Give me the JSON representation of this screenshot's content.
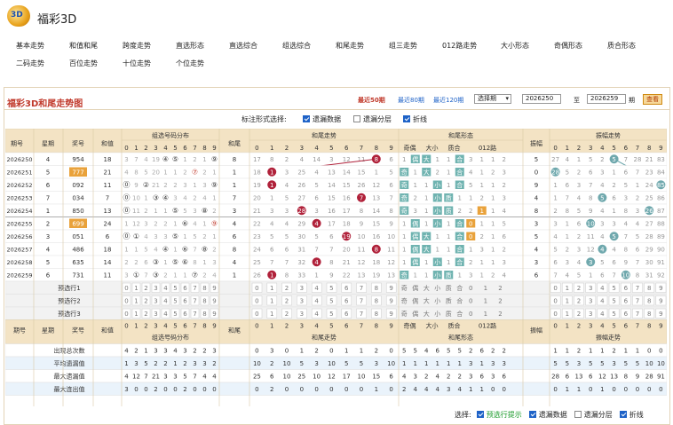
{
  "brand": "福彩3D",
  "nav": [
    "基本走势",
    "和值和尾",
    "跨度走势",
    "直选形态",
    "直选综合",
    "组选综合",
    "和尾走势",
    "组三走势",
    "012路走势",
    "大小形态",
    "奇偶形态",
    "质合形态",
    "二码走势",
    "百位走势",
    "十位走势",
    "个位走势"
  ],
  "panel_title": "福彩3D和尾走势图",
  "range_links": [
    "最近50期",
    "最近80期",
    "最近120期"
  ],
  "period_select": "选择期",
  "from_value": "2026250",
  "to_label": "至",
  "to_value": "2026259",
  "period_unit": "期",
  "query_button": "查看",
  "options_label": "标注形式选择:",
  "options": [
    {
      "label": "遗漏数据",
      "checked": true
    },
    {
      "label": "遗漏分层",
      "checked": false
    },
    {
      "label": "折线",
      "checked": true
    }
  ],
  "colors": {
    "accent_red": "#c0392b",
    "header_bg": "#f3e3c4",
    "sum_line": "#b0213a",
    "amp_line": "#6fa8ad",
    "blue_cb": "#1e62c7"
  },
  "headers": {
    "issue": "期号",
    "week": "星期",
    "prize": "奖号",
    "sum": "和值",
    "group_dist": "组选号码分布",
    "sum_tail": "和尾",
    "sum_tail_trend": "和尾走势",
    "sum_form": "和尾形态",
    "odd_even": "奇偶",
    "big_small": "大小",
    "prime": "质合",
    "road": "012路",
    "amplitude": "振幅",
    "amp_trend": "振幅走势"
  },
  "form_labels": {
    "odd": "奇",
    "even": "偶",
    "big": "大",
    "small": "小",
    "prime": "质",
    "composite": "合"
  },
  "digits": [
    "0",
    "1",
    "2",
    "3",
    "4",
    "5",
    "6",
    "7",
    "8",
    "9"
  ],
  "roads": [
    "0",
    "1",
    "2"
  ],
  "rows": [
    {
      "issue": "2026250",
      "week": "4",
      "prize": "954",
      "sum": "18",
      "dist": [
        "3",
        "7",
        "4",
        "19",
        "④",
        "⑤",
        "1",
        "2",
        "1",
        "⑨"
      ],
      "tail": "8",
      "tt": [
        "17",
        "8",
        "2",
        "4",
        "14",
        "3",
        "12",
        "11",
        "8",
        "6"
      ],
      "fm": [
        "1",
        "偶",
        "大",
        "1",
        "1",
        "合",
        "3",
        "1",
        "1",
        "2"
      ],
      "amp": "5",
      "at": [
        "27",
        "4",
        "1",
        "5",
        "2",
        "5",
        "7",
        "28",
        "21",
        "83"
      ]
    },
    {
      "issue": "2026251",
      "week": "5",
      "prize": "777",
      "sum": "21",
      "dist": [
        "4",
        "8",
        "5",
        "20",
        "1",
        "1",
        "2",
        "⑦",
        "2",
        "1"
      ],
      "tail": "1",
      "tt": [
        "18",
        "1",
        "3",
        "25",
        "4",
        "13",
        "14",
        "15",
        "1",
        "5"
      ],
      "fm": [
        "奇",
        "1",
        "大",
        "2",
        "1",
        "合",
        "4",
        "1",
        "2",
        "3"
      ],
      "amp": "0",
      "at": [
        "28",
        "5",
        "2",
        "6",
        "3",
        "1",
        "6",
        "7",
        "23",
        "84"
      ]
    },
    {
      "issue": "2026252",
      "week": "6",
      "prize": "092",
      "sum": "11",
      "dist": [
        "⓪",
        "9",
        "②",
        "21",
        "2",
        "2",
        "3",
        "1",
        "3",
        "⑨"
      ],
      "tail": "1",
      "tt": [
        "19",
        "1",
        "4",
        "26",
        "5",
        "14",
        "15",
        "26",
        "12",
        "6"
      ],
      "fm": [
        "奇",
        "1",
        "1",
        "小",
        "1",
        "合",
        "5",
        "1",
        "1",
        "2"
      ],
      "amp": "9",
      "at": [
        "1",
        "6",
        "3",
        "7",
        "4",
        "2",
        "5",
        "1",
        "24",
        "85"
      ]
    },
    {
      "issue": "2026253",
      "week": "7",
      "prize": "034",
      "sum": "7",
      "dist": [
        "⓪",
        "10",
        "1",
        "③",
        "④",
        "3",
        "4",
        "2",
        "4",
        "1"
      ],
      "tail": "7",
      "tt": [
        "20",
        "1",
        "5",
        "27",
        "6",
        "15",
        "16",
        "7",
        "13",
        "7"
      ],
      "fm": [
        "奇",
        "2",
        "1",
        "小",
        "质",
        "1",
        "1",
        "2",
        "1",
        "3"
      ],
      "amp": "4",
      "at": [
        "1",
        "7",
        "4",
        "8",
        "5",
        "6",
        "3",
        "2",
        "25",
        "86"
      ]
    },
    {
      "issue": "2026254",
      "week": "1",
      "prize": "850",
      "sum": "13",
      "dist": [
        "⓪",
        "11",
        "2",
        "1",
        "1",
        "⑤",
        "5",
        "3",
        "⑧",
        "2"
      ],
      "tail": "3",
      "tt": [
        "21",
        "3",
        "3",
        "28",
        "3",
        "16",
        "17",
        "8",
        "14",
        "8"
      ],
      "fm": [
        "奇",
        "3",
        "1",
        "小",
        "质",
        "2",
        "2",
        "0",
        "1",
        "4"
      ],
      "amp": "8",
      "at": [
        "2",
        "8",
        "5",
        "9",
        "4",
        "1",
        "8",
        "3",
        "26",
        "87"
      ]
    },
    {
      "issue": "2026255",
      "week": "2",
      "prize": "699",
      "sum": "24",
      "dist": [
        "1",
        "12",
        "3",
        "2",
        "2",
        "1",
        "⑥",
        "4",
        "1",
        "⑨"
      ],
      "tail": "4",
      "tt": [
        "22",
        "4",
        "4",
        "29",
        "4",
        "17",
        "18",
        "9",
        "15",
        "9"
      ],
      "fm": [
        "1",
        "偶",
        "1",
        "小",
        "1",
        "合",
        "0",
        "1",
        "1",
        "5"
      ],
      "amp": "3",
      "at": [
        "3",
        "1",
        "6",
        "10",
        "3",
        "3",
        "4",
        "4",
        "27",
        "88"
      ]
    },
    {
      "issue": "2026256",
      "week": "3",
      "prize": "051",
      "sum": "6",
      "dist": [
        "⓪",
        "①",
        "4",
        "3",
        "3",
        "⑤",
        "1",
        "5",
        "2",
        "1"
      ],
      "tail": "6",
      "tt": [
        "23",
        "5",
        "5",
        "30",
        "5",
        "6",
        "19",
        "10",
        "16",
        "10"
      ],
      "fm": [
        "1",
        "偶",
        "大",
        "1",
        "1",
        "合",
        "0",
        "2",
        "1",
        "6"
      ],
      "amp": "5",
      "at": [
        "4",
        "1",
        "2",
        "11",
        "4",
        "5",
        "7",
        "5",
        "28",
        "89"
      ]
    },
    {
      "issue": "2026257",
      "week": "4",
      "prize": "486",
      "sum": "18",
      "dist": [
        "1",
        "1",
        "5",
        "4",
        "④",
        "1",
        "⑥",
        "7",
        "⑧",
        "2"
      ],
      "tail": "8",
      "tt": [
        "24",
        "6",
        "6",
        "31",
        "7",
        "7",
        "20",
        "11",
        "8",
        "11"
      ],
      "fm": [
        "1",
        "偶",
        "大",
        "1",
        "1",
        "合",
        "1",
        "3",
        "1",
        "2"
      ],
      "amp": "4",
      "at": [
        "5",
        "2",
        "3",
        "12",
        "4",
        "4",
        "8",
        "6",
        "29",
        "90"
      ]
    },
    {
      "issue": "2026258",
      "week": "5",
      "prize": "635",
      "sum": "14",
      "dist": [
        "2",
        "2",
        "6",
        "③",
        "1",
        "⑤",
        "⑥",
        "8",
        "1",
        "3"
      ],
      "tail": "4",
      "tt": [
        "25",
        "7",
        "7",
        "32",
        "4",
        "8",
        "21",
        "12",
        "18",
        "12"
      ],
      "fm": [
        "1",
        "偶",
        "1",
        "小",
        "1",
        "合",
        "2",
        "1",
        "1",
        "3"
      ],
      "amp": "3",
      "at": [
        "6",
        "3",
        "4",
        "3",
        "5",
        "6",
        "9",
        "7",
        "30",
        "91"
      ]
    },
    {
      "issue": "2026259",
      "week": "6",
      "prize": "731",
      "sum": "11",
      "dist": [
        "3",
        "①",
        "7",
        "③",
        "2",
        "1",
        "1",
        "⑦",
        "2",
        "4"
      ],
      "tail": "1",
      "tt": [
        "26",
        "1",
        "8",
        "33",
        "1",
        "9",
        "22",
        "13",
        "19",
        "13"
      ],
      "fm": [
        "奇",
        "1",
        "1",
        "小",
        "质",
        "1",
        "3",
        "1",
        "2",
        "4"
      ],
      "amp": "6",
      "at": [
        "7",
        "4",
        "5",
        "1",
        "6",
        "7",
        "10",
        "8",
        "31",
        "92"
      ]
    }
  ],
  "line_sum": [
    8,
    1,
    1,
    7,
    3,
    4,
    6,
    8,
    4,
    1
  ],
  "line_amp": [
    5,
    7,
    0,
    4,
    8,
    3,
    5,
    4,
    3,
    6
  ],
  "highlight_prizes": [
    "777",
    "699"
  ],
  "pre_rows": [
    {
      "label": "预选行1"
    },
    {
      "label": "预选行2"
    },
    {
      "label": "预选行3"
    }
  ],
  "pre_form": [
    "奇",
    "偶",
    "大",
    "小",
    "质",
    "合",
    "0",
    "1",
    "2"
  ],
  "stat_rows": [
    {
      "label": "出现总次数",
      "dist": [
        "4",
        "2",
        "1",
        "3",
        "3",
        "4",
        "3",
        "2",
        "2",
        "3"
      ],
      "tt": [
        "0",
        "3",
        "0",
        "1",
        "2",
        "0",
        "1",
        "1",
        "2",
        "0"
      ],
      "fm": [
        "5",
        "5",
        "4",
        "6",
        "5",
        "5",
        "2",
        "6",
        "2",
        "2"
      ],
      "at": [
        "1",
        "1",
        "2",
        "1",
        "1",
        "2",
        "1",
        "1",
        "0",
        "0"
      ]
    },
    {
      "label": "平均遗漏值",
      "dist": [
        "1",
        "3",
        "5",
        "2",
        "2",
        "1",
        "2",
        "3",
        "3",
        "2"
      ],
      "tt": [
        "10",
        "2",
        "10",
        "5",
        "3",
        "10",
        "5",
        "5",
        "3",
        "10"
      ],
      "fm": [
        "1",
        "1",
        "1",
        "1",
        "1",
        "1",
        "3",
        "1",
        "3",
        "3"
      ],
      "at": [
        "5",
        "5",
        "3",
        "5",
        "5",
        "3",
        "5",
        "5",
        "10",
        "10"
      ]
    },
    {
      "label": "最大遗漏值",
      "dist": [
        "4",
        "12",
        "7",
        "21",
        "3",
        "3",
        "5",
        "7",
        "4",
        "4"
      ],
      "tt": [
        "25",
        "6",
        "10",
        "25",
        "10",
        "12",
        "17",
        "10",
        "15",
        "6"
      ],
      "fm": [
        "4",
        "3",
        "2",
        "4",
        "2",
        "2",
        "3",
        "6",
        "3",
        "6"
      ],
      "at": [
        "28",
        "6",
        "13",
        "6",
        "12",
        "13",
        "8",
        "9",
        "28",
        "91"
      ]
    },
    {
      "label": "最大连出值",
      "dist": [
        "3",
        "0",
        "0",
        "2",
        "0",
        "0",
        "2",
        "0",
        "0",
        "0"
      ],
      "tt": [
        "0",
        "2",
        "0",
        "0",
        "0",
        "0",
        "0",
        "0",
        "1",
        "0"
      ],
      "fm": [
        "2",
        "4",
        "4",
        "4",
        "3",
        "4",
        "1",
        "1",
        "0",
        "0"
      ],
      "at": [
        "0",
        "1",
        "1",
        "0",
        "1",
        "0",
        "0",
        "0",
        "0",
        "0"
      ]
    }
  ],
  "bottom": {
    "label": "选择:",
    "items": [
      {
        "label": "预选行提示",
        "checked": true,
        "green": true
      },
      {
        "label": "遗漏数据",
        "checked": true
      },
      {
        "label": "遗漏分层",
        "checked": false
      },
      {
        "label": "折线",
        "checked": true
      }
    ]
  }
}
